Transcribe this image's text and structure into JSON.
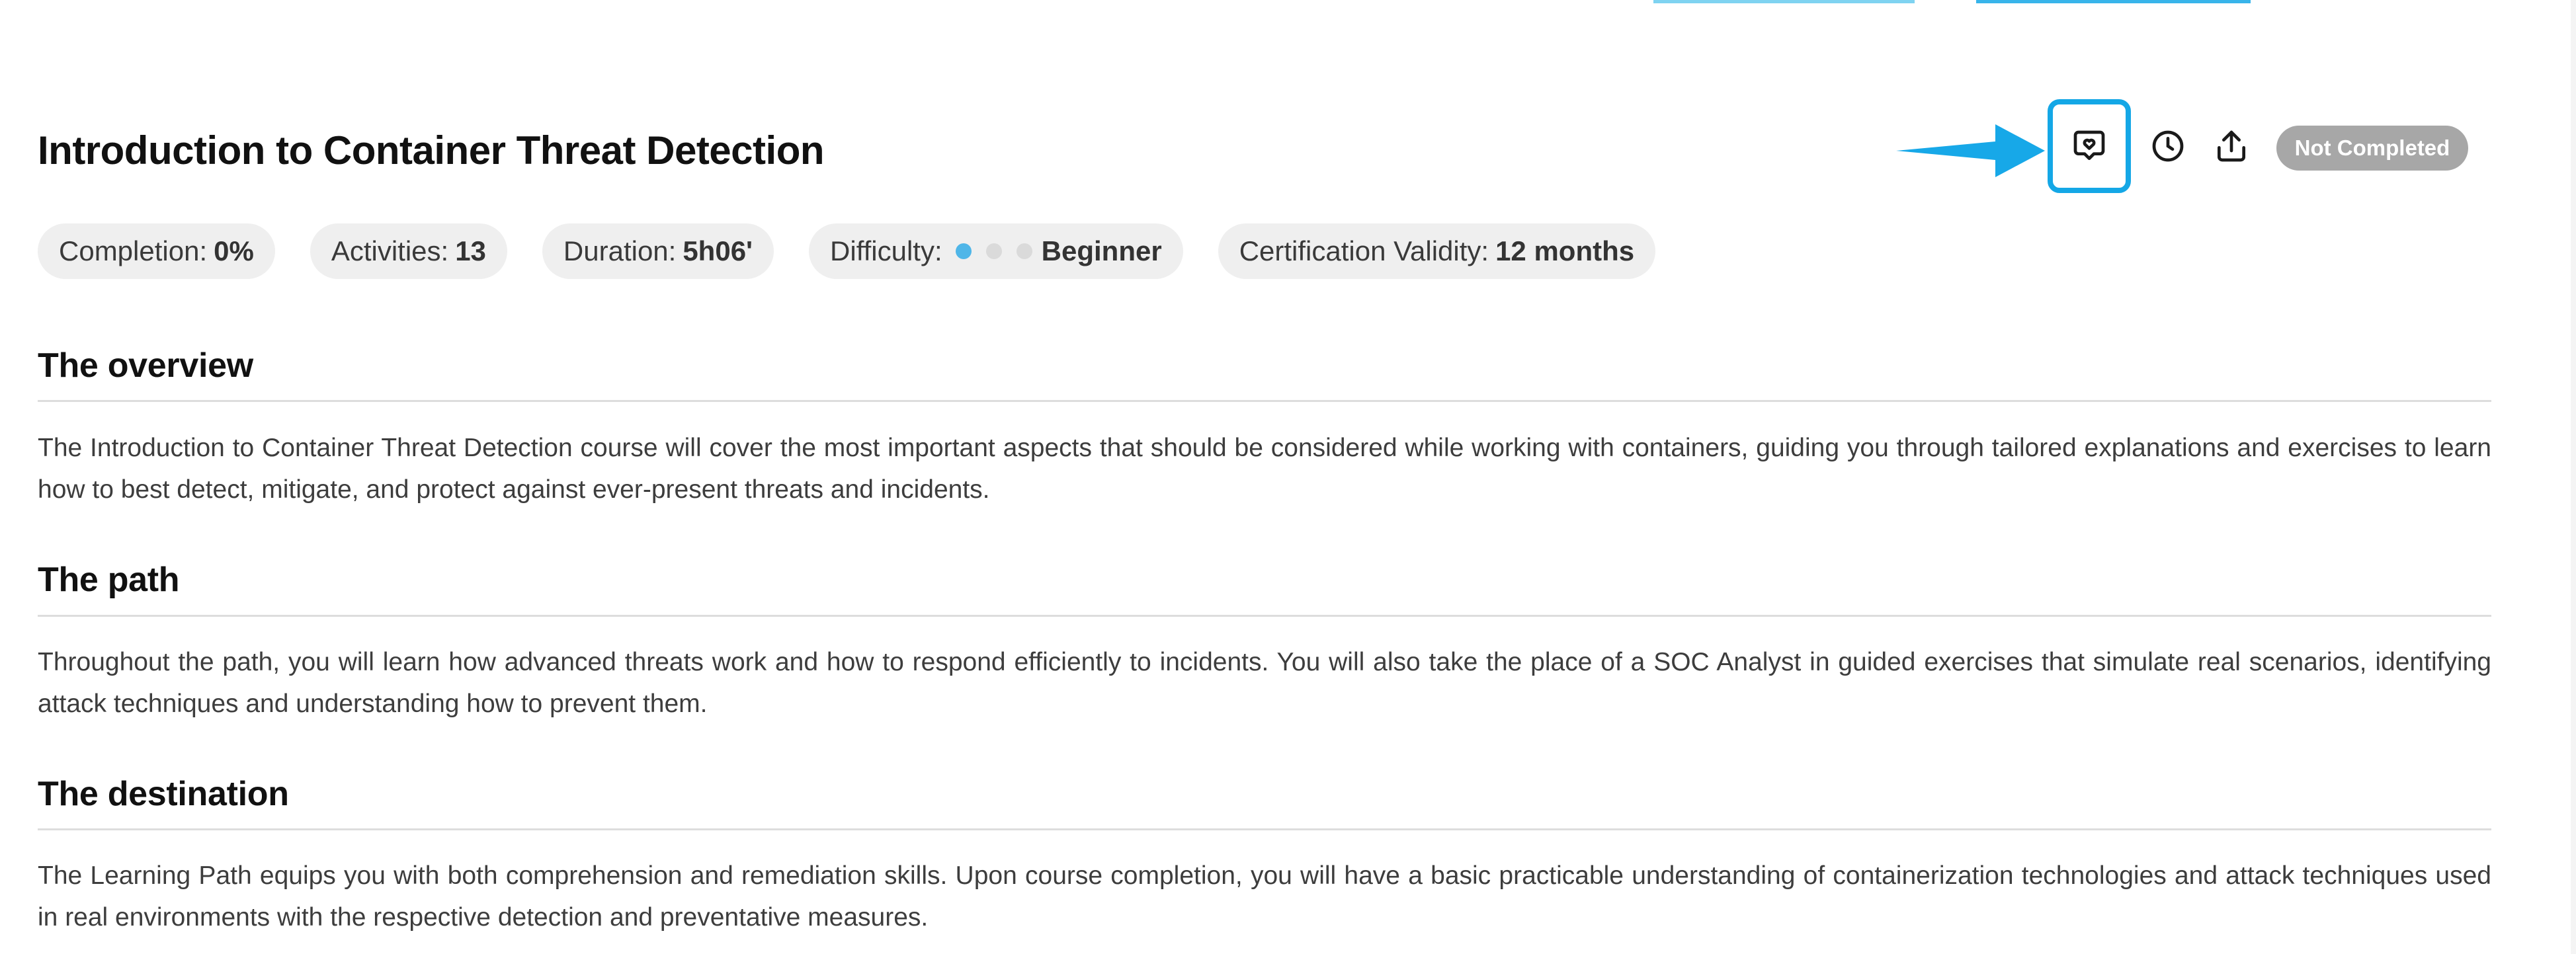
{
  "course": {
    "title": "Introduction to Container Threat Detection",
    "status": "Not Completed"
  },
  "actions": {
    "icons": [
      "favorite-heart-bubble-icon",
      "history-clock-icon",
      "share-upload-icon"
    ],
    "highlight_color": "#14a7e6",
    "arrow_color": "#17a8e8"
  },
  "stats": {
    "completion_label": "Completion:",
    "completion_value": "0%",
    "activities_label": "Activities:",
    "activities_value": "13",
    "duration_label": "Duration:",
    "duration_value": "5h06'",
    "difficulty_label": "Difficulty:",
    "difficulty_value": "Beginner",
    "difficulty_level": 1,
    "difficulty_max": 3,
    "validity_label": "Certification Validity:",
    "validity_value": "12 months"
  },
  "sections": {
    "overview": {
      "heading": "The overview",
      "text": "The Introduction to Container Threat Detection course will cover the most important aspects that should be considered while working with containers, guiding you through tailored explanations and exercises to learn how to best detect, mitigate, and protect against ever-present threats and incidents."
    },
    "path": {
      "heading": "The path",
      "text": "Throughout the path, you will learn how advanced threats work and how to respond efficiently to incidents. You will also take the place of a SOC Analyst in guided exercises that simulate real scenarios, identifying attack techniques and understanding how to prevent them."
    },
    "destination": {
      "heading": "The destination",
      "text": "The Learning Path equips you with both comprehension and remediation skills. Upon course completion, you will have a basic practicable understanding of containerization technologies and attack techniques used in real environments with the respective detection and preventative measures."
    }
  }
}
